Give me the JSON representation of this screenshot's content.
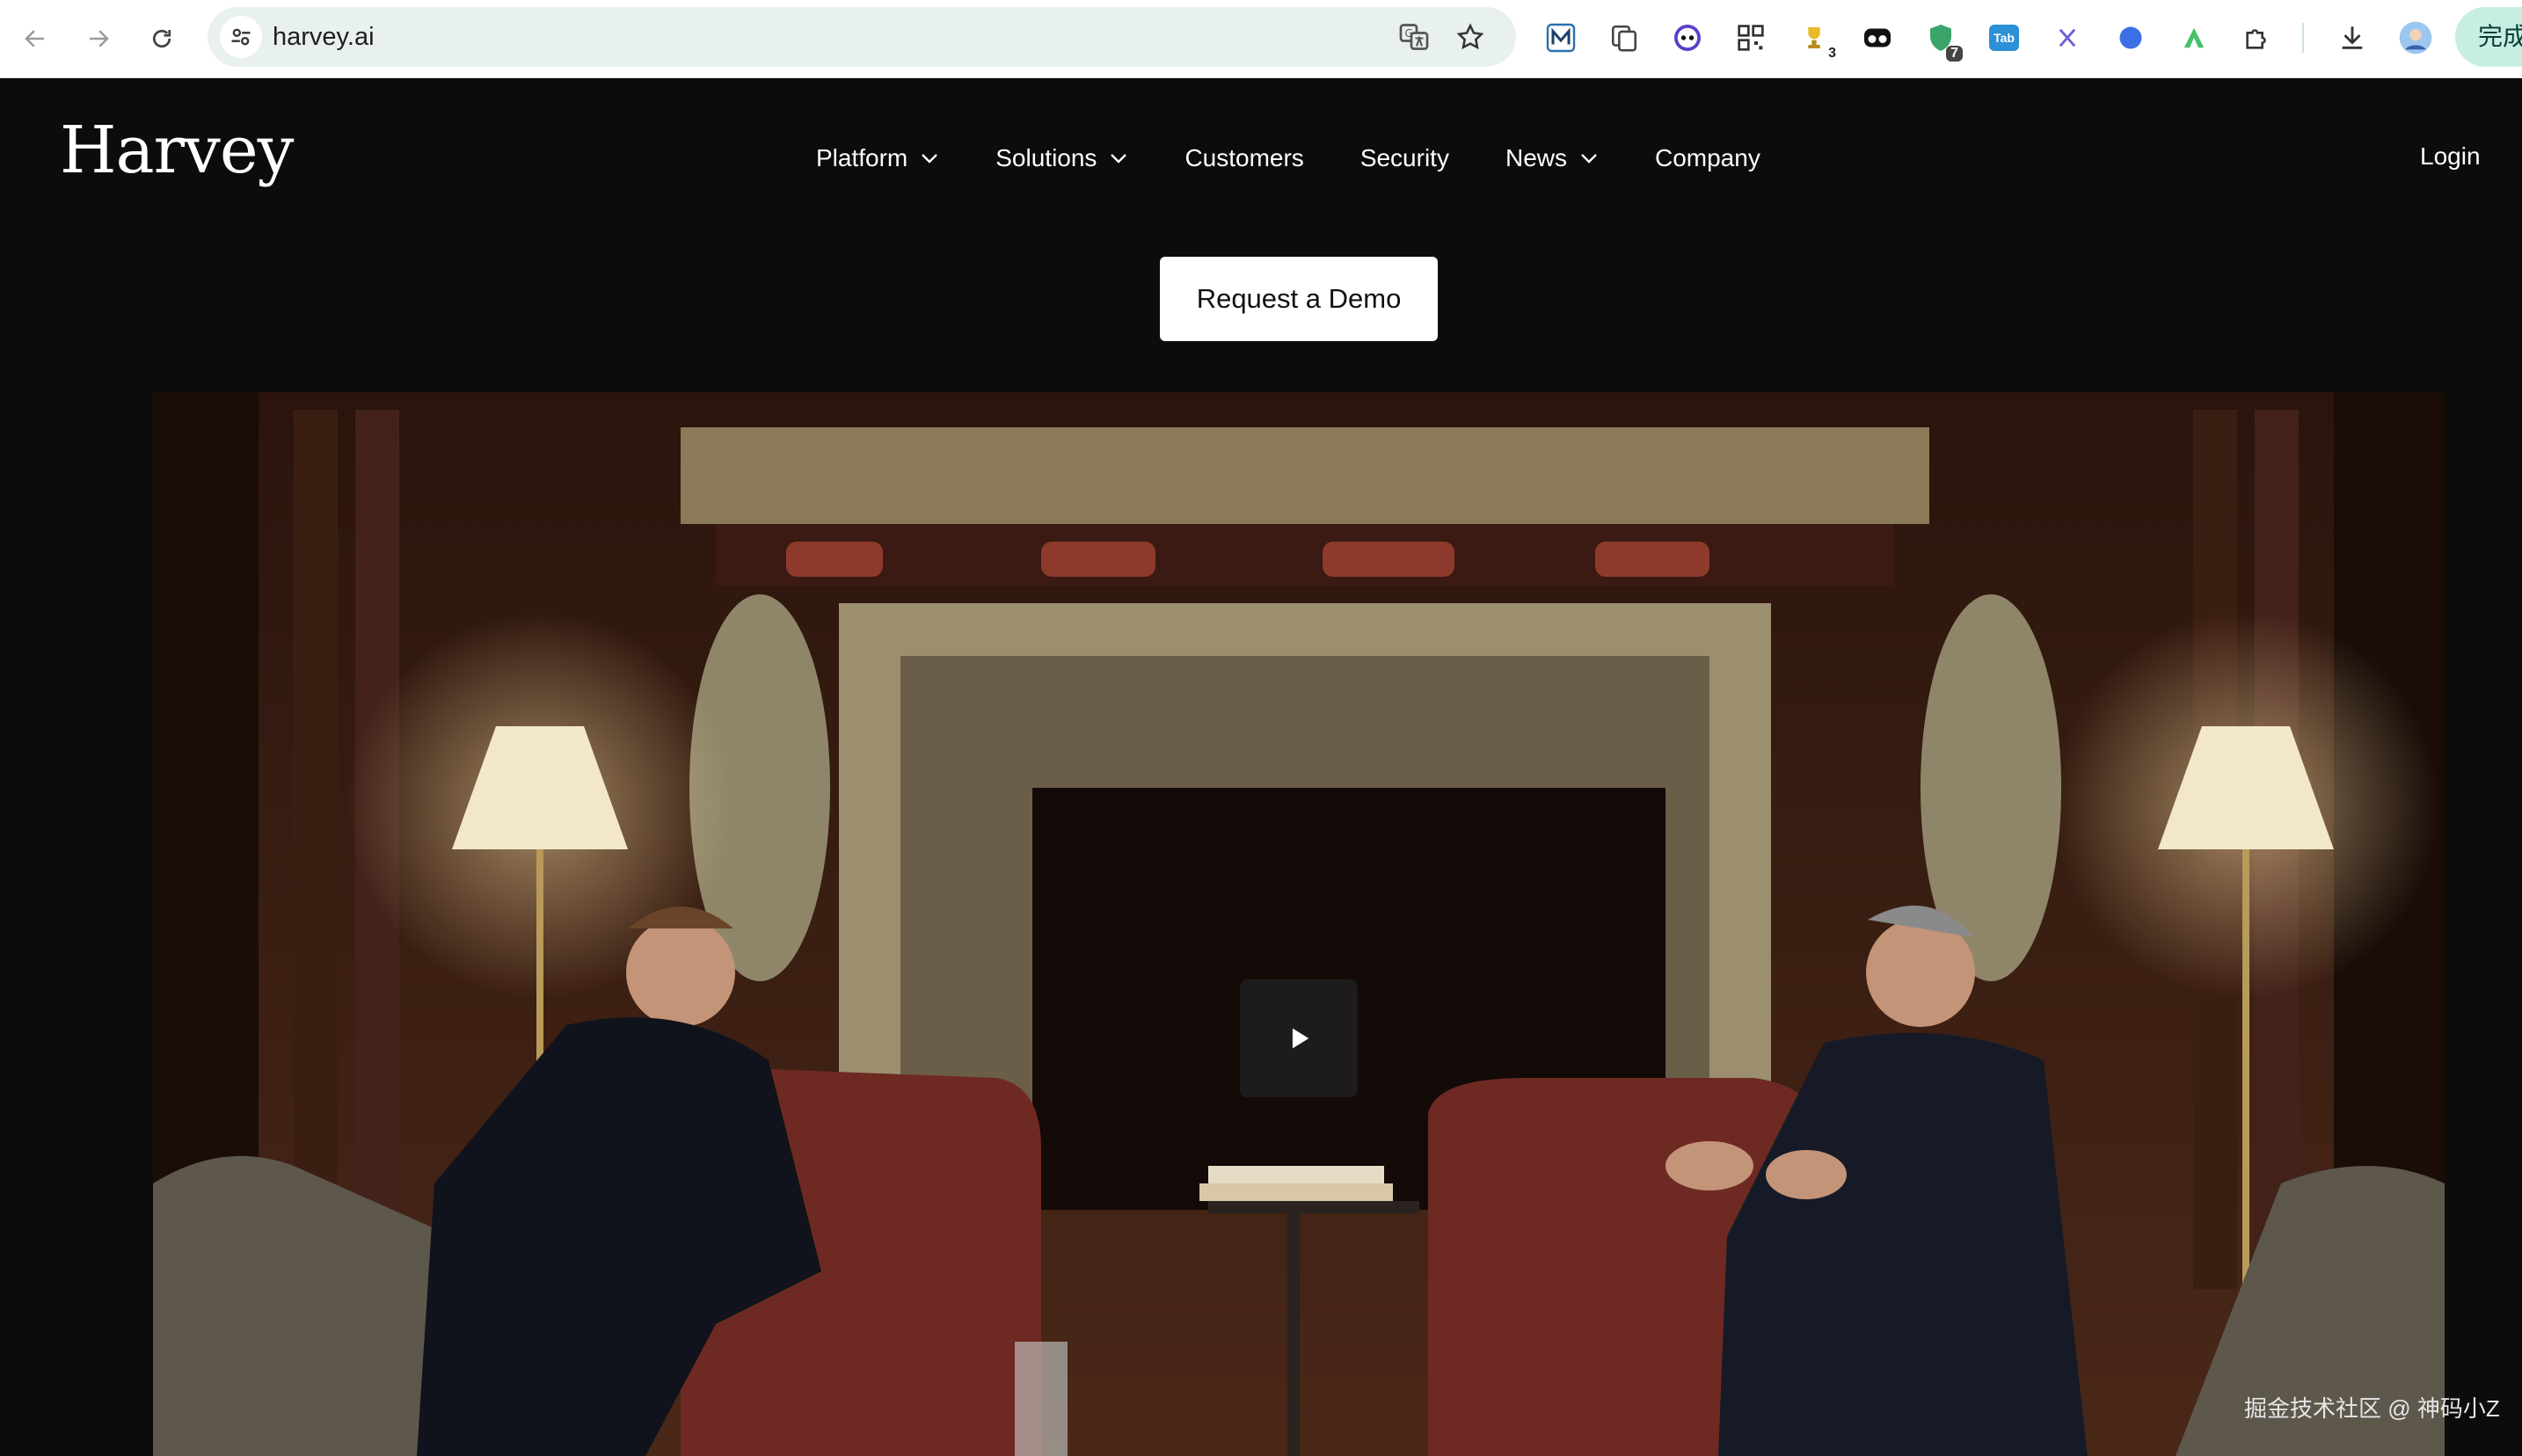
{
  "browser": {
    "url": "harvey.ai",
    "done_label": "完成",
    "extension_badges": {
      "trophy": "3",
      "shield": "7",
      "tab": "Tab"
    }
  },
  "site": {
    "logo": "Harvey",
    "nav": [
      {
        "label": "Platform",
        "has_dropdown": true
      },
      {
        "label": "Solutions",
        "has_dropdown": true
      },
      {
        "label": "Customers",
        "has_dropdown": false
      },
      {
        "label": "Security",
        "has_dropdown": false
      },
      {
        "label": "News",
        "has_dropdown": true
      },
      {
        "label": "Company",
        "has_dropdown": false
      }
    ],
    "login": "Login",
    "cta": "Request a Demo"
  },
  "hero": {
    "play_icon": "play-icon"
  },
  "watermark": "掘金技术社区 @ 神码小Z",
  "colors": {
    "page_bg": "#0e0c0b",
    "cta_bg": "#ffffff",
    "omnibox_bg": "#e9f1ee",
    "done_bg": "#c8eee4"
  }
}
